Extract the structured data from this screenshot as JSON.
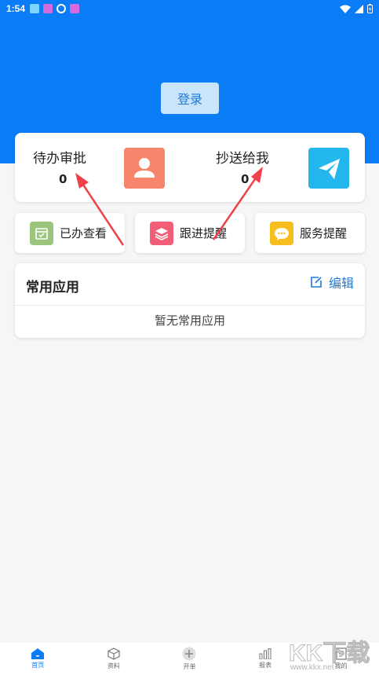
{
  "status_bar": {
    "time": "1:54"
  },
  "header": {
    "login_label": "登录"
  },
  "summary": {
    "pending_label": "待办审批",
    "pending_count": "0",
    "cc_label": "抄送给我",
    "cc_count": "0"
  },
  "quick_actions": [
    {
      "label": "已办查看",
      "color": "#9bc57d"
    },
    {
      "label": "跟进提醒",
      "color": "#f25e77"
    },
    {
      "label": "服务提醒",
      "color": "#f7bf1e"
    }
  ],
  "common_apps": {
    "title": "常用应用",
    "edit_label": "编辑",
    "empty_text": "暂无常用应用"
  },
  "tabs": [
    {
      "label": "首页",
      "icon": "home-icon",
      "active": true
    },
    {
      "label": "资料",
      "icon": "cube-icon",
      "active": false
    },
    {
      "label": "开单",
      "icon": "plus-circle-icon",
      "active": false
    },
    {
      "label": "报表",
      "icon": "bar-chart-icon",
      "active": false
    },
    {
      "label": "我的",
      "icon": "document-icon",
      "active": false
    }
  ],
  "watermark": {
    "brand": "KK下载",
    "url": "www.kkx.net"
  },
  "colors": {
    "primary": "#0a7cf6",
    "login_bg": "#c9e4fb",
    "tile_orange": "#f7856b",
    "tile_blue": "#23b7ed",
    "arrow": "#f0404a"
  }
}
